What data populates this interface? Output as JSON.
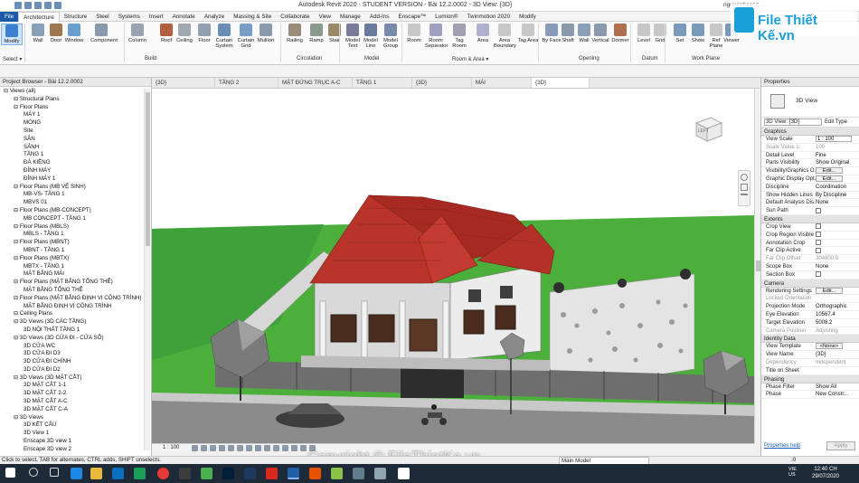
{
  "window": {
    "title": "Autodesk Revit 2020 - STUDENT VERSION - Bài 12.2.0002 - 3D View: {3D}",
    "user": "nguyenhoang..."
  },
  "ribbon_tabs": [
    "File",
    "Architecture",
    "Structure",
    "Steel",
    "Systems",
    "Insert",
    "Annotate",
    "Analyze",
    "Massing & Site",
    "Collaborate",
    "View",
    "Manage",
    "Add-Ins",
    "Enscape™",
    "Lumion®",
    "Twinmotion 2020",
    "Modify"
  ],
  "ribbon": {
    "buttons": [
      {
        "label": "Modify",
        "color": "#3b7fd0"
      },
      {
        "label": "Wall",
        "color": "#8aa0b8"
      },
      {
        "label": "Door",
        "color": "#a07850"
      },
      {
        "label": "Window",
        "color": "#6aa0d0"
      },
      {
        "label": "Component",
        "color": "#8899aa"
      },
      {
        "label": "Column",
        "color": "#9aa4ae"
      },
      {
        "label": "Roof",
        "color": "#b06040"
      },
      {
        "label": "Ceiling",
        "color": "#a0a8b0"
      },
      {
        "label": "Floor",
        "color": "#90a0b0"
      },
      {
        "label": "Curtain System",
        "color": "#6a8db5"
      },
      {
        "label": "Curtain Grid",
        "color": "#7a9dc5"
      },
      {
        "label": "Mullion",
        "color": "#8a9aa8"
      },
      {
        "label": "Railing",
        "color": "#9a8a7a"
      },
      {
        "label": "Ramp",
        "color": "#8a9a8a"
      },
      {
        "label": "Stair",
        "color": "#9a8a6a"
      },
      {
        "label": "Model Text",
        "color": "#7a7a9a"
      },
      {
        "label": "Model Line",
        "color": "#6a7a9a"
      },
      {
        "label": "Model Group",
        "color": "#7a8aaa"
      },
      {
        "label": "Room",
        "color": "#c8c8c8"
      },
      {
        "label": "Room Separator",
        "color": "#a0a0c0"
      },
      {
        "label": "Tag Room",
        "color": "#a0a0b0"
      },
      {
        "label": "Area",
        "color": "#b0b0d0"
      },
      {
        "label": "Area Boundary",
        "color": "#c8c8c8"
      },
      {
        "label": "Tag Area",
        "color": "#c8c8c8"
      },
      {
        "label": "By Face",
        "color": "#8a9aba"
      },
      {
        "label": "Shaft",
        "color": "#8a9aaa"
      },
      {
        "label": "Wall",
        "color": "#8aa0b8"
      },
      {
        "label": "Vertical",
        "color": "#8a9aaa"
      },
      {
        "label": "Dormer",
        "color": "#b07050"
      },
      {
        "label": "Level",
        "color": "#c8c8c8"
      },
      {
        "label": "Grid",
        "color": "#c8c8c8"
      },
      {
        "label": "Set",
        "color": "#7a9aba"
      },
      {
        "label": "Show",
        "color": "#7a9aba"
      },
      {
        "label": "Ref Plane",
        "color": "#c8c8c8"
      },
      {
        "label": "Viewer",
        "color": "#7a9aba"
      }
    ],
    "groups": [
      "Select ▾",
      "Build",
      "Circulation",
      "Model",
      "Room & Area ▾",
      "Opening",
      "Datum",
      "Work Plane"
    ]
  },
  "brand": {
    "text": "File Thiết Kế.vn"
  },
  "project_browser": {
    "title": "Project Browser - Bài 12.2.0002",
    "items": [
      {
        "t": "Views (all)",
        "lvl": 0
      },
      {
        "t": "Structural Plans",
        "lvl": 1
      },
      {
        "t": "Floor Plans",
        "lvl": 1
      },
      {
        "t": "MÁY 1",
        "lvl": 2
      },
      {
        "t": "MÓNG",
        "lvl": 2
      },
      {
        "t": "Site",
        "lvl": 2
      },
      {
        "t": "SÂN",
        "lvl": 2
      },
      {
        "t": "SẢNH",
        "lvl": 2
      },
      {
        "t": "TẦNG 1",
        "lvl": 2
      },
      {
        "t": "ĐÀ KIỀNG",
        "lvl": 2
      },
      {
        "t": "ĐỈNH MÁY",
        "lvl": 2
      },
      {
        "t": "ĐỈNH MÁY 1",
        "lvl": 2
      },
      {
        "t": "Floor Plans (MB VỆ SINH)",
        "lvl": 1
      },
      {
        "t": "MB-VS- TẦNG 1",
        "lvl": 2
      },
      {
        "t": "MBVS 01",
        "lvl": 2
      },
      {
        "t": "Floor Plans (MB-CONCEPT)",
        "lvl": 1
      },
      {
        "t": "MB CONCEPT - TẦNG 1",
        "lvl": 2
      },
      {
        "t": "Floor Plans (MBLS)",
        "lvl": 1
      },
      {
        "t": "MBLS - TẦNG 1",
        "lvl": 2
      },
      {
        "t": "Floor Plans (MBNT)",
        "lvl": 1
      },
      {
        "t": "MBNT - TẦNG 1",
        "lvl": 2
      },
      {
        "t": "Floor Plans (MBTX)",
        "lvl": 1
      },
      {
        "t": "MBTX - TẦNG 1",
        "lvl": 2
      },
      {
        "t": "MẶT BẰNG MÁI",
        "lvl": 2
      },
      {
        "t": "Floor Plans (MẶT BẰNG TỔNG THỂ)",
        "lvl": 1
      },
      {
        "t": "MẶT BẰNG TỔNG THỂ",
        "lvl": 2
      },
      {
        "t": "Floor Plans (MẶT BẰNG ĐỊNH VỊ CÔNG TRÌNH)",
        "lvl": 1
      },
      {
        "t": "MẶT BẰNG ĐỊNH VỊ CÔNG TRÌNH",
        "lvl": 2
      },
      {
        "t": "Ceiling Plans",
        "lvl": 1
      },
      {
        "t": "3D Views (3D CÁC TẦNG)",
        "lvl": 1
      },
      {
        "t": "3D NỘI THẤT TẦNG 1",
        "lvl": 2
      },
      {
        "t": "3D Views (3D CỬA ĐI - CỬA SỔ)",
        "lvl": 1
      },
      {
        "t": "3D CỬA WC",
        "lvl": 2
      },
      {
        "t": "3D CỬA ĐI D3",
        "lvl": 2
      },
      {
        "t": "3D CỬA ĐI CHÍNH",
        "lvl": 2
      },
      {
        "t": "3D CỬA ĐI D2",
        "lvl": 2
      },
      {
        "t": "3D Views (3D MẶT CẮT)",
        "lvl": 1
      },
      {
        "t": "3D MẶT CẮT 1-1",
        "lvl": 2
      },
      {
        "t": "3D MẶT CẮT 2-2",
        "lvl": 2
      },
      {
        "t": "3D MẶT CẮT A-C",
        "lvl": 2
      },
      {
        "t": "3D MẶT CẮT C-A",
        "lvl": 2
      },
      {
        "t": "3D Views",
        "lvl": 1
      },
      {
        "t": "3D KẾT CẤU",
        "lvl": 2
      },
      {
        "t": "3D View 1",
        "lvl": 2
      },
      {
        "t": "Enscape 3D view 1",
        "lvl": 2
      },
      {
        "t": "Enscape 3D view 2",
        "lvl": 2
      }
    ]
  },
  "view_tabs": [
    "{3D}",
    "TẦNG 2",
    "MẶT ĐỨNG TRỤC A-C",
    "TẦNG 1",
    "{3D}",
    "MÁI",
    "{3D}"
  ],
  "viewcube": {
    "face": "LEFT"
  },
  "view_control": {
    "scale": "1 : 100"
  },
  "properties": {
    "title": "Properties",
    "type_name": "3D View",
    "selector": "3D View: {3D}",
    "edit_type": "Edit Type",
    "sections": [
      {
        "name": "Graphics",
        "rows": [
          {
            "k": "View Scale",
            "v": "1 : 100",
            "kind": "box"
          },
          {
            "k": "Scale Value  1:",
            "v": "100",
            "kind": "dis"
          },
          {
            "k": "Detail Level",
            "v": "Fine"
          },
          {
            "k": "Parts Visibility",
            "v": "Show Original"
          },
          {
            "k": "Visibility/Graphics O...",
            "v": "Edit...",
            "kind": "btn"
          },
          {
            "k": "Graphic Display Opt...",
            "v": "Edit...",
            "kind": "btn"
          },
          {
            "k": "Discipline",
            "v": "Coordination"
          },
          {
            "k": "Show Hidden Lines",
            "v": "By Discipline"
          },
          {
            "k": "Default Analysis Dis...",
            "v": "None"
          },
          {
            "k": "Sun Path",
            "v": "",
            "kind": "cb"
          }
        ]
      },
      {
        "name": "Extents",
        "rows": [
          {
            "k": "Crop View",
            "v": "",
            "kind": "cb"
          },
          {
            "k": "Crop Region Visible",
            "v": "",
            "kind": "cb"
          },
          {
            "k": "Annotation Crop",
            "v": "",
            "kind": "cb"
          },
          {
            "k": "Far Clip Active",
            "v": "",
            "kind": "cb"
          },
          {
            "k": "Far Clip Offset",
            "v": "304800.0",
            "kind": "dis"
          },
          {
            "k": "Scope Box",
            "v": "None"
          },
          {
            "k": "Section Box",
            "v": "",
            "kind": "cb"
          }
        ]
      },
      {
        "name": "Camera",
        "rows": [
          {
            "k": "Rendering Settings",
            "v": "Edit...",
            "kind": "btn"
          },
          {
            "k": "Locked Orientation",
            "v": "",
            "kind": "dis"
          },
          {
            "k": "Projection Mode",
            "v": "Orthographic"
          },
          {
            "k": "Eye Elevation",
            "v": "10567.4"
          },
          {
            "k": "Target Elevation",
            "v": "5008.2"
          },
          {
            "k": "Camera Position",
            "v": "Adjusting",
            "kind": "dis"
          }
        ]
      },
      {
        "name": "Identity Data",
        "rows": [
          {
            "k": "View Template",
            "v": "<None>",
            "kind": "btn"
          },
          {
            "k": "View Name",
            "v": "{3D}"
          },
          {
            "k": "Dependency",
            "v": "Independent",
            "kind": "dis"
          },
          {
            "k": "Title on Sheet",
            "v": ""
          }
        ]
      },
      {
        "name": "Phasing",
        "rows": [
          {
            "k": "Phase Filter",
            "v": "Show All"
          },
          {
            "k": "Phase",
            "v": "New Constr..."
          }
        ]
      }
    ],
    "help_link": "Properties help",
    "apply": "Apply"
  },
  "status": {
    "hint": "Click to select, TAB for alternates, CTRL adds, SHIFT unselects.",
    "model": "Main Model",
    "count": ":0"
  },
  "watermark": "Copyright © FileThietKe.vn",
  "taskbar": {
    "lang": "VIE\nUS",
    "time": "12:40 CH",
    "date": "29/07/2020"
  }
}
